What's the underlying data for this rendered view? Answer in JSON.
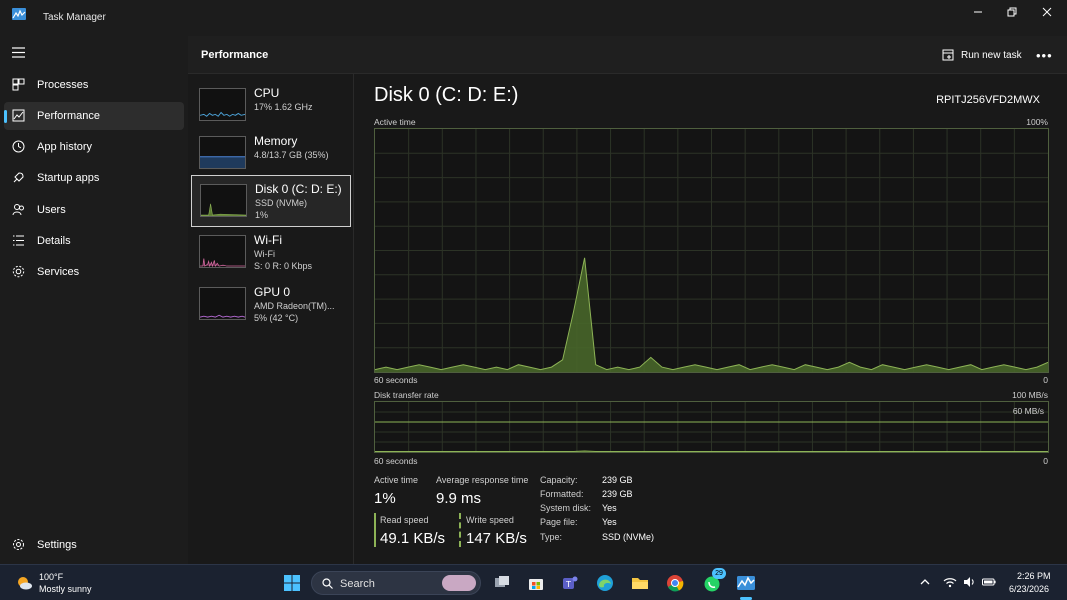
{
  "window": {
    "title": "Task Manager"
  },
  "nav": {
    "items": [
      {
        "label": "Processes",
        "icon": "processes-icon"
      },
      {
        "label": "Performance",
        "icon": "performance-icon",
        "active": true
      },
      {
        "label": "App history",
        "icon": "history-icon"
      },
      {
        "label": "Startup apps",
        "icon": "startup-icon"
      },
      {
        "label": "Users",
        "icon": "users-icon"
      },
      {
        "label": "Details",
        "icon": "details-icon"
      },
      {
        "label": "Services",
        "icon": "services-icon"
      }
    ],
    "settings_label": "Settings"
  },
  "header": {
    "title": "Performance",
    "run_new_task": "Run new task"
  },
  "devices": [
    {
      "name": "CPU",
      "line1": "17%  1.62 GHz",
      "line2": "",
      "color": "#4ca3d9"
    },
    {
      "name": "Memory",
      "line1": "4.8/13.7 GB (35%)",
      "line2": "",
      "color": "#4c86d9"
    },
    {
      "name": "Disk 0 (C: D: E:)",
      "line1": "SSD (NVMe)",
      "line2": "1%",
      "color": "#8db356",
      "selected": true
    },
    {
      "name": "Wi-Fi",
      "line1": "Wi-Fi",
      "line2": "S: 0  R: 0 Kbps",
      "color": "#d46aa0"
    },
    {
      "name": "GPU 0",
      "line1": "AMD Radeon(TM)...",
      "line2": "5%  (42 °C)",
      "color": "#b56ad4"
    }
  ],
  "disk": {
    "title": "Disk 0 (C: D: E:)",
    "model": "RPITJ256VFD2MWX",
    "active_time_label": "Active time",
    "active_time_max": "100%",
    "active_time_window": "60 seconds",
    "active_time_min": "0",
    "transfer_label": "Disk transfer rate",
    "transfer_max": "100 MB/s",
    "transfer_mid": "60 MB/s",
    "transfer_window": "60 seconds",
    "transfer_min": "0",
    "accent_color": "#8db356"
  },
  "chart_data": [
    {
      "type": "area",
      "title": "Active time",
      "ylim": [
        0,
        100
      ],
      "x_range_seconds": [
        60,
        0
      ],
      "values": [
        1,
        2,
        1,
        2,
        3,
        2,
        1,
        2,
        3,
        2,
        1,
        2,
        1,
        3,
        2,
        1,
        2,
        5,
        25,
        47,
        3,
        1,
        2,
        1,
        2,
        6,
        2,
        1,
        2,
        3,
        2,
        1,
        2,
        3,
        1,
        2,
        3,
        2,
        1,
        3,
        2,
        1,
        2,
        4,
        2,
        1,
        3,
        2,
        1,
        2,
        3,
        2,
        1,
        2,
        3,
        1,
        2,
        3,
        2,
        1,
        2,
        4
      ],
      "grid": true
    },
    {
      "type": "area",
      "title": "Disk transfer rate",
      "ylim": [
        0,
        100
      ],
      "unit": "MB/s",
      "reference_line": 60,
      "values": [
        0,
        0,
        0,
        0,
        0,
        0,
        0,
        0,
        0,
        0,
        0,
        0,
        0,
        0,
        0,
        0,
        0,
        0,
        0,
        2,
        0,
        0,
        0,
        0,
        0,
        0,
        0,
        0,
        0,
        0,
        0,
        0,
        0,
        0,
        0,
        0,
        0,
        0,
        0,
        0,
        0,
        0,
        0,
        0,
        0,
        0,
        0,
        0,
        0,
        0,
        0,
        0,
        0,
        0,
        0,
        0,
        0,
        0,
        0,
        0,
        0,
        0
      ],
      "grid": true
    }
  ],
  "stats": {
    "active_time_label": "Active time",
    "active_time_value": "1%",
    "avg_response_label": "Average response time",
    "avg_response_value": "9.9 ms",
    "read_label": "Read speed",
    "read_value": "49.1 KB/s",
    "write_label": "Write speed",
    "write_value": "147 KB/s"
  },
  "properties": [
    {
      "key": "Capacity:",
      "value": "239 GB"
    },
    {
      "key": "Formatted:",
      "value": "239 GB"
    },
    {
      "key": "System disk:",
      "value": "Yes"
    },
    {
      "key": "Page file:",
      "value": "Yes"
    },
    {
      "key": "Type:",
      "value": "SSD (NVMe)"
    }
  ],
  "taskbar": {
    "weather_temp": "100°F",
    "weather_desc": "Mostly sunny",
    "search_label": "Search",
    "whatsapp_badge": "29",
    "time": "2:26 PM",
    "date": "6/23/2026"
  }
}
